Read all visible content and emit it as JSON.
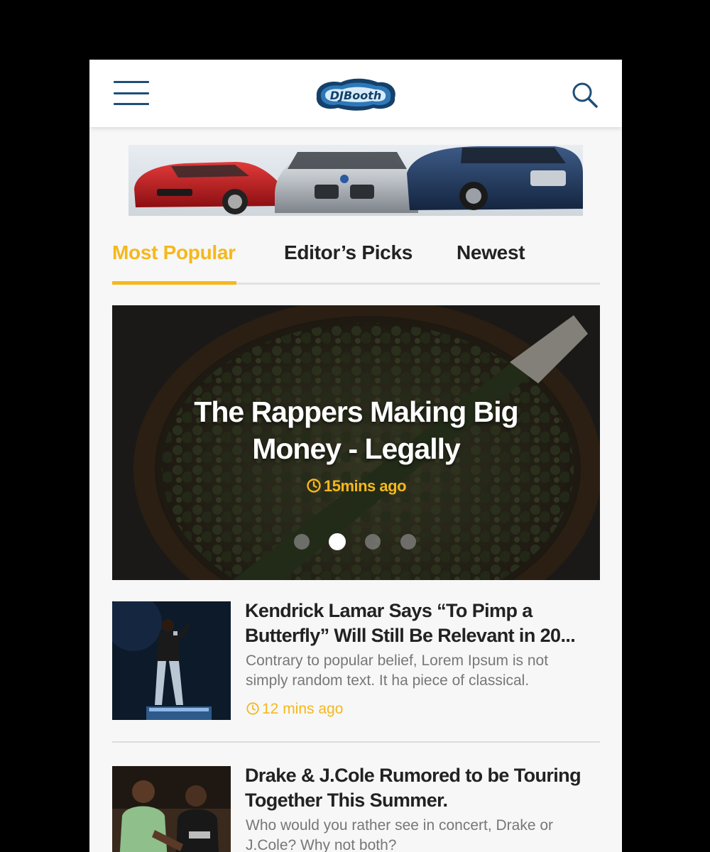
{
  "header": {
    "logo_text": "DJBooth",
    "menu_icon": "hamburger-menu-icon",
    "search_icon": "search-icon"
  },
  "ad": {
    "description": "car-banner-ad"
  },
  "tabs": [
    {
      "label": "Most Popular",
      "active": true
    },
    {
      "label": "Editor’s Picks",
      "active": false
    },
    {
      "label": "Newest",
      "active": false
    }
  ],
  "hero": {
    "title_line1": "The Rappers Making Big",
    "title_line2": "Money - Legally",
    "time": "15mins ago",
    "slide_count": 4,
    "active_slide": 2
  },
  "articles": [
    {
      "title": "Kendrick Lamar Says “To Pimp a Butterfly” Will Still Be Relevant in 20...",
      "description": "Contrary to popular belief, Lorem Ipsum is not simply random text. It ha piece of classical.",
      "time": "12 mins ago"
    },
    {
      "title": "Drake & J.Cole Rumored to be Touring Together This Summer.",
      "description": "Who would you rather see in concert, Drake or J.Cole? Why not both?",
      "time": ""
    }
  ],
  "colors": {
    "accent": "#f5b81c",
    "brand_blue": "#1d4f7a",
    "text": "#222222",
    "muted": "#777777"
  }
}
